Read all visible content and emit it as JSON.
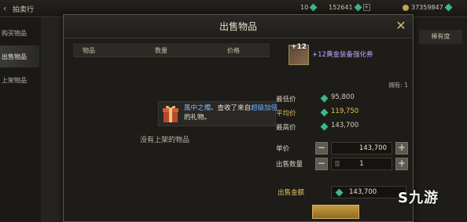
{
  "topbar": {
    "back_icon": "back-arrow-icon",
    "title": "拍卖行",
    "currencies": [
      {
        "value": "10",
        "icon": "gem-icon"
      },
      {
        "value": "152641",
        "icon": "gem-icon"
      },
      {
        "value": "37359847",
        "icon": "coin-icon"
      }
    ]
  },
  "leftnav": {
    "items": [
      {
        "label": "购买物品"
      },
      {
        "label": "出售物品"
      },
      {
        "label": "上架物品"
      }
    ]
  },
  "rightcol": {
    "header": "稀有度"
  },
  "modal": {
    "title": "出售物品",
    "list_headers": [
      "物品",
      "数量",
      "价格"
    ],
    "empty_text": "没有上架的物品"
  },
  "notice": {
    "name": "風中之燭",
    "text_mid": "、查收了来自",
    "highlight": "超级加倍",
    "text_end": "的礼物。"
  },
  "item": {
    "level": "+12",
    "name": "+12黄金装备强化券",
    "owned": "拥有: 1"
  },
  "prices": {
    "min_label": "最低价",
    "min_value": "95,800",
    "avg_label": "平均价",
    "avg_value": "119,750",
    "max_label": "最高价",
    "max_value": "143,700"
  },
  "controls": {
    "unit_label": "单价",
    "unit_value": "143,700",
    "qty_label": "出售数量",
    "qty_value": "1",
    "total_label": "出售金额",
    "total_value": "143,700"
  },
  "watermark": {
    "text": "九游"
  },
  "colors": {
    "gem": "#39b98a",
    "avg_price": "#e2c45c",
    "item_name": "#c0a6ff"
  }
}
